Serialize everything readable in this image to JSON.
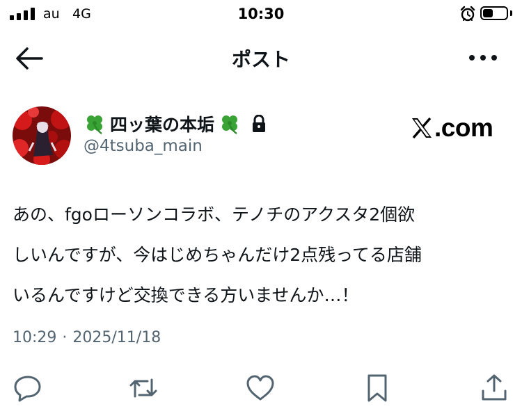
{
  "status_bar": {
    "carrier": "au",
    "network": "4G",
    "time": "10:30",
    "battery_level": 0.45,
    "icons": [
      "signal-icon",
      "alarm-icon",
      "battery-icon"
    ]
  },
  "nav": {
    "title": "ポスト",
    "icons": [
      "back-arrow-icon",
      "more-icon"
    ]
  },
  "author": {
    "display_name": "四ッ葉の本垢",
    "handle": "@4tsuba_main",
    "icons": [
      "clover-icon",
      "lock-icon"
    ]
  },
  "watermark": {
    "text": ".com"
  },
  "post": {
    "lines": [
      "あの、fgoローソンコラボ、テノチのアクスタ2個欲",
      "しいんですが、今はじめちゃんだけ2点残ってる店舗",
      "いるんですけど交換できる方いませんか…！"
    ],
    "time": "10:29",
    "separator": "·",
    "date": "2025/11/18"
  },
  "actions": {
    "icons": [
      "reply-icon",
      "repost-icon",
      "like-icon",
      "bookmark-icon",
      "share-icon"
    ]
  },
  "colors": {
    "text": "#0f1419",
    "secondary": "#536471"
  }
}
